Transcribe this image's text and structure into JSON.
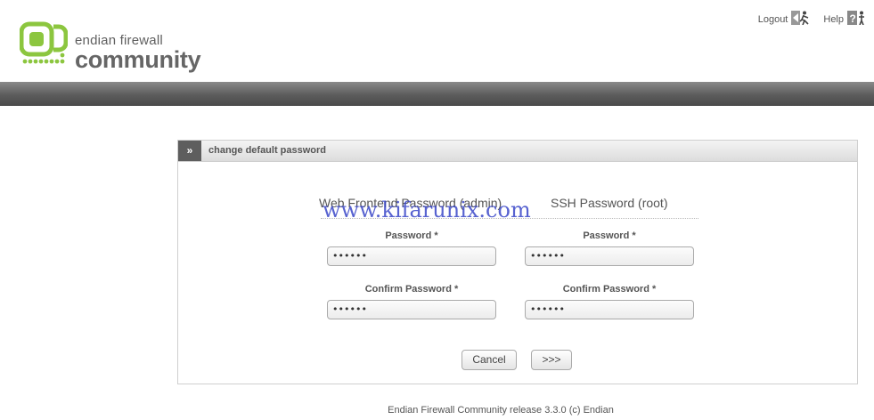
{
  "brand": {
    "line1": "endian firewall",
    "line2": "community",
    "color": "#8cc63f"
  },
  "toplinks": {
    "logout": "Logout",
    "help": "Help"
  },
  "panel": {
    "arrow": "»",
    "title": "change default password"
  },
  "columns": {
    "web": "Web Frontend Password (admin)",
    "ssh": "SSH Password (root)"
  },
  "fields": {
    "web_password_label": "Password *",
    "web_password_value": "••••••",
    "web_confirm_label": "Confirm Password *",
    "web_confirm_value": "••••••",
    "ssh_password_label": "Password *",
    "ssh_password_value": "••••••",
    "ssh_confirm_label": "Confirm Password *",
    "ssh_confirm_value": "••••••"
  },
  "buttons": {
    "cancel": "Cancel",
    "next": ">>>"
  },
  "watermark": "www.kifarunix.com",
  "footer": "Endian Firewall Community release 3.3.0 (c) Endian"
}
